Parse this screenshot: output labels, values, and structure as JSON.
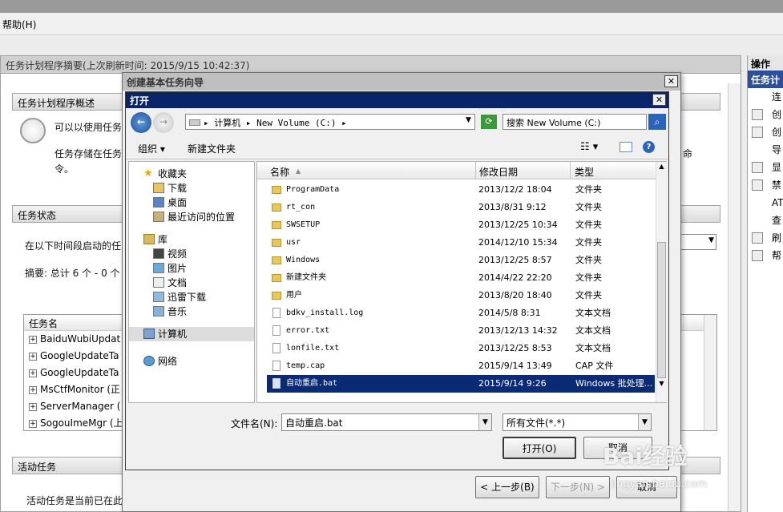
{
  "menubar": {
    "help": "帮助(H)"
  },
  "main": {
    "title": "任务计划程序摘要(上次刷新时间: 2015/9/15 10:42:37)",
    "overview": {
      "header": "任务计划程序概述",
      "line1": "可以以使用任务计",
      "line2": "任务存储在任务",
      "line3": "令。",
      "line_right": "命"
    },
    "status": {
      "header": "任务状态",
      "line1": "在以下时间段启动的任",
      "summary": "摘要: 总计 6 个 - 0 个"
    },
    "tasks": {
      "column": "任务名",
      "rows": [
        "BaiduWubiUpdat",
        "GoogleUpdateTa",
        "GoogleUpdateTa",
        "MsCtfMonitor (正",
        "ServerManager (",
        "SogouImeMgr (上"
      ]
    },
    "active": {
      "header": "活动任务",
      "line1": "活动任务是当前已在此"
    }
  },
  "right": {
    "header": "操作",
    "subheader": "任务计",
    "items": [
      "连",
      "创",
      "创",
      "导",
      "显",
      "禁",
      "AT",
      "查",
      "刷",
      "帮"
    ]
  },
  "wizard": {
    "title": "创建基本任务向导",
    "back": "< 上一步(B)",
    "next": "下一步(N) >",
    "cancel": "取消"
  },
  "dialog": {
    "title": "打开",
    "address": "▸ 计算机 ▸ New Volume (C:) ▸",
    "search": "搜索 New Volume (C:)",
    "organize": "组织",
    "new_folder": "新建文件夹",
    "nav": {
      "favorites": "收藏夹",
      "fav_items": [
        "下载",
        "桌面",
        "最近访问的位置"
      ],
      "library": "库",
      "lib_items": [
        "视频",
        "图片",
        "文档",
        "迅雷下载",
        "音乐"
      ],
      "computer": "计算机",
      "network": "网络"
    },
    "columns": {
      "name": "名称",
      "date": "修改日期",
      "type": "类型"
    },
    "files": [
      {
        "name": "ProgramData",
        "date": "2013/12/2 18:04",
        "type": "文件夹",
        "kind": "folder"
      },
      {
        "name": "rt_con",
        "date": "2013/8/31 9:12",
        "type": "文件夹",
        "kind": "folder"
      },
      {
        "name": "SWSETUP",
        "date": "2013/12/25 10:34",
        "type": "文件夹",
        "kind": "folder"
      },
      {
        "name": "usr",
        "date": "2014/12/10 15:34",
        "type": "文件夹",
        "kind": "folder"
      },
      {
        "name": "Windows",
        "date": "2013/12/25 8:57",
        "type": "文件夹",
        "kind": "folder"
      },
      {
        "name": "新建文件夹",
        "date": "2014/4/22 22:20",
        "type": "文件夹",
        "kind": "folder"
      },
      {
        "name": "用户",
        "date": "2013/8/20 18:40",
        "type": "文件夹",
        "kind": "folder"
      },
      {
        "name": "bdkv_install.log",
        "date": "2014/5/8 8:31",
        "type": "文本文档",
        "kind": "file"
      },
      {
        "name": "error.txt",
        "date": "2013/12/13 14:32",
        "type": "文本文档",
        "kind": "file"
      },
      {
        "name": "lonfile.txt",
        "date": "2013/12/25 8:53",
        "type": "文本文档",
        "kind": "file"
      },
      {
        "name": "temp.cap",
        "date": "2015/9/14 13:49",
        "type": "CAP 文件",
        "kind": "file"
      },
      {
        "name": "自动重启.bat",
        "date": "2015/9/14 9:26",
        "type": "Windows 批处理...",
        "kind": "bat",
        "selected": true
      }
    ],
    "filename_label": "文件名(N):",
    "filename_value": "自动重启.bat",
    "filter": "所有文件(*.*)",
    "open": "打开(O)",
    "cancel": "取消"
  },
  "watermark": {
    "text": "Bai经验",
    "sub": "jingyan.baidu.com"
  }
}
